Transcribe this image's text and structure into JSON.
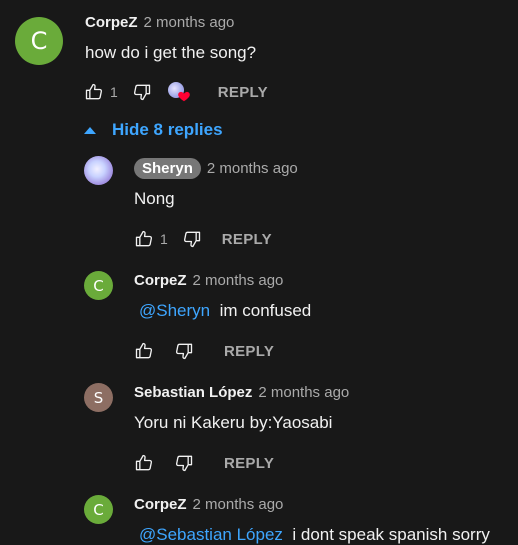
{
  "colors": {
    "background": "#181818",
    "link": "#3ea6ff",
    "avatar_green": "#6aab3a",
    "avatar_brown": "#8d6e63",
    "heart": "#ff0033"
  },
  "top_comment": {
    "avatar_letter": "C",
    "author": "CorpeZ",
    "time": "2 months ago",
    "text": "how do i get the song?",
    "likes": "1",
    "reply_label": "REPLY"
  },
  "toggle": {
    "label": "Hide 8 replies",
    "icon": "chevron-up-icon"
  },
  "replies": [
    {
      "author": "Sheryn",
      "time": "2 months ago",
      "text": "Nong",
      "likes": "1",
      "reply_label": "REPLY"
    },
    {
      "avatar_letter": "C",
      "author": "CorpeZ",
      "time": "2 months ago",
      "mention": "@Sheryn",
      "text": "im confused",
      "reply_label": "REPLY"
    },
    {
      "avatar_letter": "S",
      "author": "Sebastian López",
      "time": "2 months ago",
      "text": "Yoru ni Kakeru by:Yaosabi",
      "reply_label": "REPLY"
    },
    {
      "avatar_letter": "C",
      "author": "CorpeZ",
      "time": "2 months ago",
      "mention": "@Sebastian López",
      "text": "i dont speak spanish sorry"
    }
  ]
}
